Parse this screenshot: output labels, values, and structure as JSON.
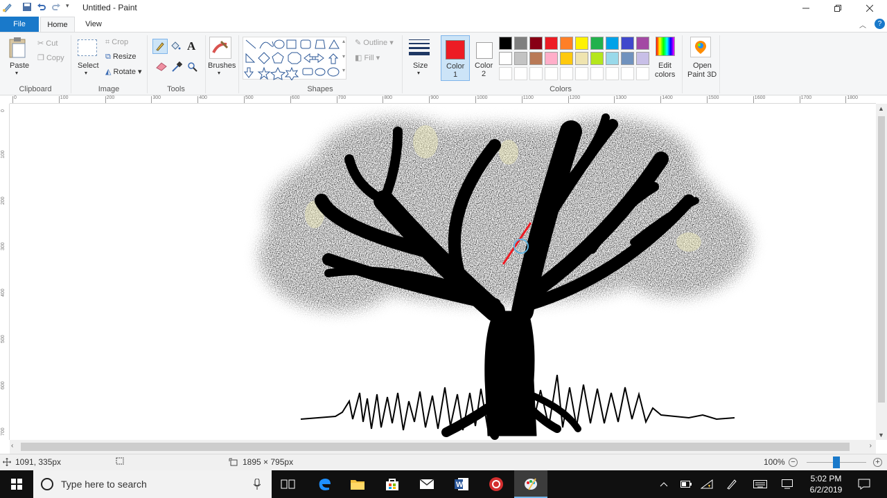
{
  "window": {
    "title": "Untitled - Paint"
  },
  "tabs": {
    "file": "File",
    "home": "Home",
    "view": "View"
  },
  "ribbon": {
    "clipboard": {
      "paste": "Paste",
      "cut": "Cut",
      "copy": "Copy",
      "group": "Clipboard"
    },
    "image": {
      "select": "Select",
      "crop": "Crop",
      "resize": "Resize",
      "rotate": "Rotate",
      "group": "Image"
    },
    "tools": {
      "group": "Tools"
    },
    "brushes": {
      "label": "Brushes"
    },
    "shapes": {
      "outline": "Outline",
      "fill": "Fill",
      "group": "Shapes"
    },
    "size": {
      "label": "Size"
    },
    "color1": {
      "line1": "Color",
      "line2": "1",
      "value": "#ed1c24"
    },
    "color2": {
      "line1": "Color",
      "line2": "2",
      "value": "#ffffff"
    },
    "colors": {
      "group": "Colors",
      "edit_line1": "Edit",
      "edit_line2": "colors",
      "row1": [
        "#000000",
        "#7f7f7f",
        "#880015",
        "#ed1c24",
        "#ff7f27",
        "#fff200",
        "#22b14c",
        "#00a2e8",
        "#3f48cc",
        "#a349a4"
      ],
      "row2": [
        "#ffffff",
        "#c3c3c3",
        "#b97a57",
        "#ffaec9",
        "#ffc90e",
        "#efe4b0",
        "#b5e61d",
        "#99d9ea",
        "#7092be",
        "#c8bfe7"
      ]
    },
    "paint3d": {
      "line1": "Open",
      "line2": "Paint 3D"
    }
  },
  "ruler": {
    "h": [
      "0",
      "100",
      "200",
      "300",
      "400",
      "500",
      "600",
      "700",
      "800",
      "900",
      "1000",
      "1100",
      "1200",
      "1300",
      "1400",
      "1500",
      "1600",
      "1700",
      "1800"
    ],
    "v": [
      "0",
      "100",
      "200",
      "300",
      "400",
      "500",
      "600",
      "700"
    ]
  },
  "status": {
    "cursor_pos": "1091, 335px",
    "canvas_size": "1895 × 795px",
    "zoom": "100%"
  },
  "taskbar": {
    "search_placeholder": "Type here to search",
    "time": "5:02 PM",
    "date": "6/2/2019"
  }
}
